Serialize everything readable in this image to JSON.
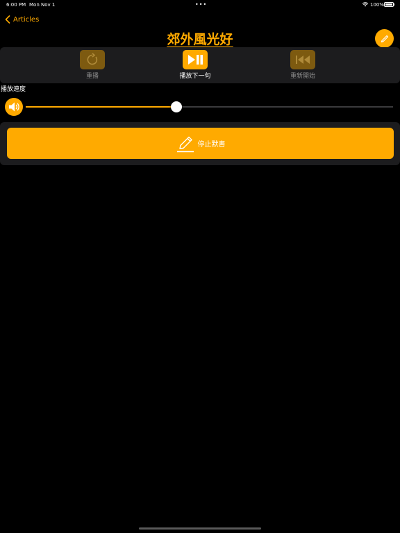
{
  "status_bar": {
    "time": "6:00 PM",
    "date": "Mon Nov 1",
    "battery": "100%"
  },
  "nav": {
    "back_label": "Articles",
    "title": "郊外風光好"
  },
  "controls": [
    {
      "label": "重播",
      "state": "disabled",
      "icon": "replay-icon"
    },
    {
      "label": "播放下一句",
      "state": "active",
      "icon": "play-pause-icon"
    },
    {
      "label": "重新開始",
      "state": "disabled",
      "icon": "rewind-to-start-icon"
    }
  ],
  "speed": {
    "label": "播放速度",
    "value_fraction": 0.41
  },
  "stop_button": {
    "label": "停止默書",
    "icon": "pencil-icon"
  },
  "colors": {
    "accent": "#ffaa00",
    "accent_dim": "#7d5a10",
    "panel": "#1c1c1e",
    "background": "#000000"
  }
}
